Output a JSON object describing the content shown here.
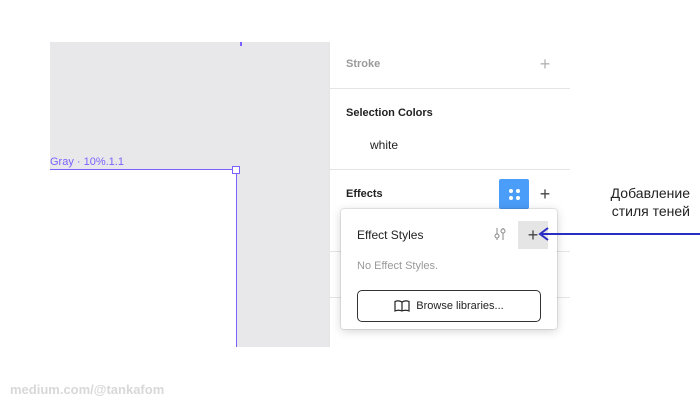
{
  "canvas": {
    "frame_label": "Gray · 10%.1.1"
  },
  "panel": {
    "stroke": {
      "title": "Stroke",
      "add_icon": "plus-icon"
    },
    "selection_colors": {
      "title": "Selection Colors",
      "values": [
        "white"
      ]
    },
    "effects": {
      "title": "Effects",
      "styles_icon": "grid-dots-icon",
      "add_icon": "plus-icon"
    }
  },
  "popup": {
    "title": "Effect Styles",
    "empty_text": "No Effect Styles.",
    "browse_label": "Browse libraries...",
    "adjust_icon": "sliders-icon",
    "add_icon": "plus-icon",
    "book_icon": "book-icon"
  },
  "annotation": {
    "line1": "Добавление",
    "line2": "стиля теней",
    "arrow_color": "#2a2dc2"
  },
  "watermark": "medium.com/@tankafom",
  "colors": {
    "accent": "#4a9df8",
    "frame": "#7b61ff"
  }
}
